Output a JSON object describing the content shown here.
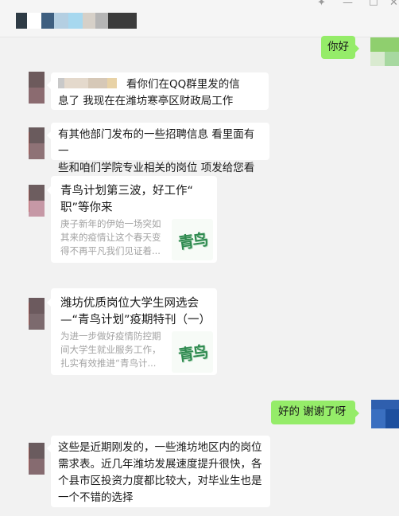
{
  "window": {
    "title_blocks": [
      "#2e3b45",
      "#ffffff",
      "#3e5f80",
      "#b4cfe2",
      "#a7d8ef",
      "#d6d0c8",
      "#b5b5b5",
      "#3b3b3b"
    ],
    "controls": [
      "pin-icon",
      "minimize-icon",
      "maximize-icon",
      "close-icon"
    ]
  },
  "colors": {
    "my_bubble": "#95ec69",
    "their_bubble": "#ffffff",
    "chat_bg": "#f2f2f2",
    "card_logo": "#2f8a50"
  },
  "messages": {
    "m1": {
      "text": "你好"
    },
    "m2": {
      "line1_tail": "看你们在QQ群里发的信",
      "line2": "息了 我现在在潍坊寒亭区财政局工作"
    },
    "m3": {
      "line1": "有其他部门发布的一些招聘信息 看里面有一",
      "line2": "些和咱们学院专业相关的岗位 项发给您看看"
    },
    "card1": {
      "title_line1": "青鸟计划第三波，好工作“",
      "title_line2": "职”等你来",
      "desc": [
        "庚子新年的伊始一场突如",
        "其来的疫情让这个春天变",
        "得不再平凡我们见证着..."
      ],
      "logo_text": "青鸟"
    },
    "card2": {
      "title_line1": "潍坊优质岗位大学生网选会",
      "title_line2": "—“青鸟计划”疫期特刊（一）",
      "desc": [
        "为进一步做好疫情防控期",
        "间大学生就业服务工作，",
        "扎实有效推进“青鸟计..."
      ],
      "logo_text": "青鸟"
    },
    "m4": {
      "text": "好的 谢谢了呀"
    },
    "m5": {
      "lines": [
        "这些是近期刚发的，一些潍坊地区内的岗位",
        "需求表。近几年潍坊发展速度提升很快，各",
        "个县市区投资力度都比较大，对毕业生也是",
        "一个不错的选择"
      ]
    }
  }
}
